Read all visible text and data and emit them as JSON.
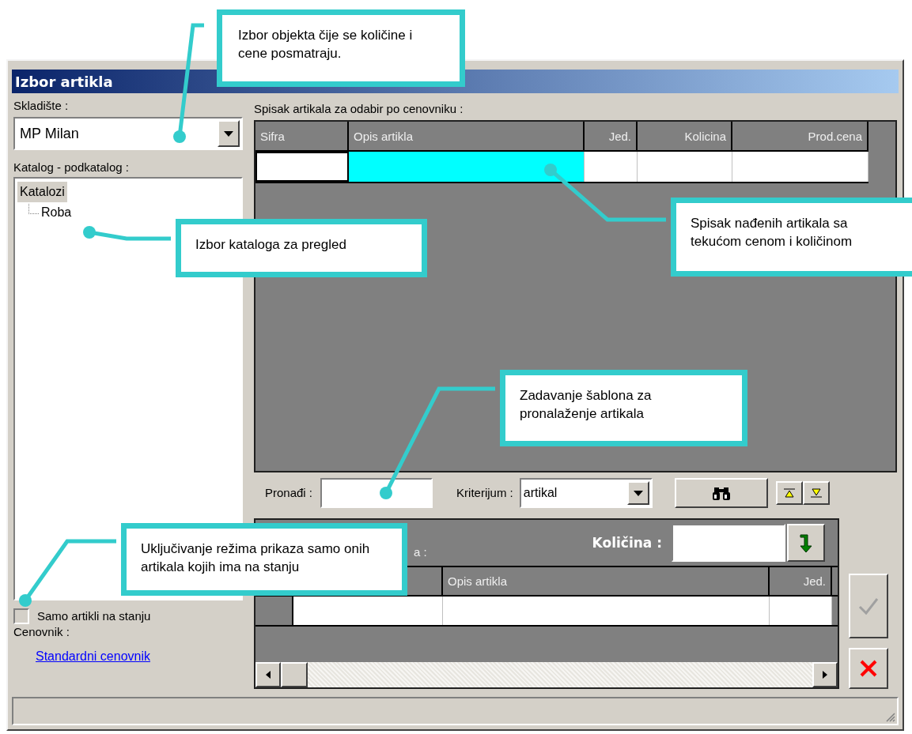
{
  "window": {
    "title": "Izbor artikla"
  },
  "warehouse": {
    "label": "Skladište :",
    "value": "MP Milan"
  },
  "catalog": {
    "label": "Katalog - podkatalog :",
    "tree": [
      {
        "label": "Katalozi",
        "selected": true,
        "children": [
          {
            "label": "Roba",
            "selected": false
          }
        ]
      }
    ]
  },
  "in_stock_only": {
    "label": "Samo artikli na stanju",
    "checked": false
  },
  "price_list": {
    "label": "Cenovnik :",
    "link": "Standardni cenovnik"
  },
  "article_list": {
    "label": "Spisak artikala za odabir po cenovniku :",
    "columns": [
      {
        "label": "Sifra",
        "selected": false
      },
      {
        "label": "Opis artikla",
        "selected": true
      },
      {
        "label": "Jed.",
        "selected": false
      },
      {
        "label": "Kolicina",
        "selected": false
      },
      {
        "label": "Prod.cena",
        "selected": false
      }
    ]
  },
  "search": {
    "label": "Pronađi :",
    "criterion_label": "Kriterijum :",
    "criterion_value": "artikal"
  },
  "selection": {
    "label_fragment": "a :",
    "quantity_label": "Količina :",
    "columns": [
      {
        "label": "Opis artikla"
      },
      {
        "label": "Jed."
      }
    ]
  },
  "buttons": [
    {
      "kind": "confirm",
      "disabled": true
    },
    {
      "kind": "cancel",
      "disabled": false
    }
  ],
  "callouts": [
    {
      "text": "Izbor objekta čije se količine i cene posmatraju."
    },
    {
      "text": "Izbor kataloga za pregled"
    },
    {
      "text": "Spisak nađenih artikala sa tekućom cenom i količinom"
    },
    {
      "text": "Zadavanje šablona za pronalaženje artikala"
    },
    {
      "text": "Uključivanje režima prikaza samo onih artikala kojih ima na stanju"
    }
  ]
}
